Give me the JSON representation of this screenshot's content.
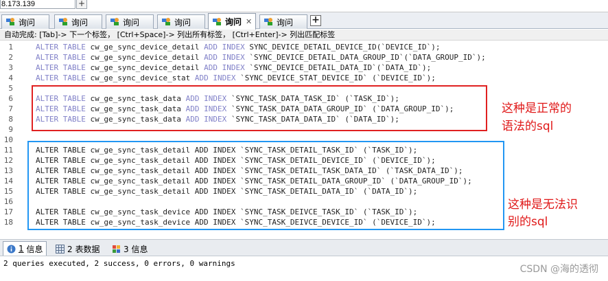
{
  "address": {
    "text": "8.173.139",
    "plus_label": "+"
  },
  "tabs": [
    {
      "label": "询问",
      "active": false
    },
    {
      "label": "询问",
      "active": false
    },
    {
      "label": "询问",
      "active": false
    },
    {
      "label": "询问",
      "active": false
    },
    {
      "label": "询问",
      "active": true,
      "close": "✕"
    },
    {
      "label": "询问",
      "active": false
    }
  ],
  "tab_add_label": "+",
  "hint": "自动完成:  [Tab]-> 下一个标签，  [Ctrl+Space]-> 列出所有标签，  [Ctrl+Enter]-> 列出匹配标签",
  "editor": {
    "lines": [
      {
        "n": "1",
        "kind": "kw",
        "text": "ALTER TABLE cw_ge_sync_device_detail ADD INDEX SYNC_DEVICE_DETAIL_DEVICE_ID(`DEVICE_ID`);"
      },
      {
        "n": "2",
        "kind": "kw",
        "text": "ALTER TABLE cw_ge_sync_device_detail ADD INDEX `SYNC_DEVICE_DETAIL_DATA_GROUP_ID`(`DATA_GROUP_ID`);"
      },
      {
        "n": "3",
        "kind": "kw",
        "text": "ALTER TABLE cw_ge_sync_device_detail ADD INDEX `SYNC_DEVICE_DETAIL_DATA_ID`(`DATA_ID`);"
      },
      {
        "n": "4",
        "kind": "kw",
        "text": "ALTER TABLE cw_ge_sync_device_stat ADD INDEX `SYNC_DEVICE_STAT_DEVICE_ID` (`DEVICE_ID`);"
      },
      {
        "n": "5",
        "kind": "blank",
        "text": ""
      },
      {
        "n": "6",
        "kind": "kw",
        "text": "ALTER TABLE cw_ge_sync_task_data ADD INDEX `SYNC_TASK_DATA_TASK_ID` (`TASK_ID`);"
      },
      {
        "n": "7",
        "kind": "kw",
        "text": "ALTER TABLE cw_ge_sync_task_data ADD INDEX `SYNC_TASK_DATA_DATA_GROUP_ID` (`DATA_GROUP_ID`);"
      },
      {
        "n": "8",
        "kind": "kw",
        "text": "ALTER TABLE cw_ge_sync_task_data ADD INDEX `SYNC_TASK_DATA_DATA_ID` (`DATA_ID`);"
      },
      {
        "n": "9",
        "kind": "blank",
        "text": ""
      },
      {
        "n": "10",
        "kind": "blank",
        "text": ""
      },
      {
        "n": "11",
        "kind": "tx",
        "text": "ALTER TABLE cw_ge_sync_task_detail ADD INDEX `SYNC_TASK_DETAIL_TASK_ID` (`TASK_ID`);"
      },
      {
        "n": "12",
        "kind": "tx",
        "text": "ALTER TABLE cw_ge_sync_task_detail ADD INDEX `SYNC_TASK_DETAIL_DEVICE_ID` (`DEVICE_ID`);"
      },
      {
        "n": "13",
        "kind": "tx",
        "text": "ALTER TABLE cw_ge_sync_task_detail ADD INDEX `SYNC_TASK_DETAIL_TASK_DATA_ID` (`TASK_DATA_ID`);"
      },
      {
        "n": "14",
        "kind": "tx",
        "text": "ALTER TABLE cw_ge_sync_task_detail ADD INDEX `SYNC_TASK_DETAIL_DATA_GROUP_ID` (`DATA_GROUP_ID`);"
      },
      {
        "n": "15",
        "kind": "tx",
        "text": "ALTER TABLE cw_ge_sync_task_detail ADD INDEX `SYNC_TASK_DETAIL_DATA_ID` (`DATA_ID`);"
      },
      {
        "n": "16",
        "kind": "blank",
        "text": ""
      },
      {
        "n": "17",
        "kind": "tx",
        "text": "ALTER TABLE cw_ge_sync_task_device ADD INDEX `SYNC_TASK_DEIVCE_TASK_ID` (`TASK_ID`);"
      },
      {
        "n": "18",
        "kind": "tx",
        "text": "ALTER TABLE cw_ge_sync_task_device ADD INDEX `SYNC_TASK_DEIVCE_DEVICE_ID` (`DEVICE_ID`);"
      }
    ]
  },
  "annotations": {
    "red_note_line1": "这种是正常的",
    "red_note_line2": "语法的sql",
    "blue_note_line1": "这种是无法识",
    "blue_note_line2": "别的sql"
  },
  "bottom_tabs": [
    {
      "num": "1",
      "label": "信息",
      "active": true
    },
    {
      "num": "2",
      "label": "表数据",
      "active": false
    },
    {
      "num": "3",
      "label": "信息",
      "active": false
    }
  ],
  "output_text": "2 queries executed, 2 success, 0 errors, 0 warnings",
  "watermark": "CSDN @海的透彻",
  "colors": {
    "keyword": "#8080c8",
    "annotation_red": "#e02020",
    "annotation_blue": "#2196f3"
  }
}
